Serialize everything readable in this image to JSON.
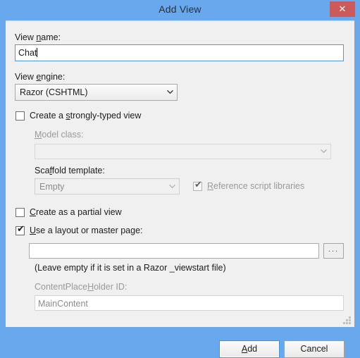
{
  "window": {
    "title": "Add View",
    "close_label": "✕",
    "titlebar_color": "#6aa8ee",
    "close_color": "#cd5a5a",
    "body_color": "#f0f0f0",
    "accent_color": "#3c99e0"
  },
  "form": {
    "view_name": {
      "label_pre": "View ",
      "label_acc": "n",
      "label_post": "ame:",
      "value": "Chat"
    },
    "view_engine": {
      "label_pre": "View ",
      "label_acc": "e",
      "label_post": "ngine:",
      "value": "Razor (CSHTML)"
    },
    "strongly_typed": {
      "label_pre": "Create a ",
      "label_acc": "s",
      "label_post": "trongly-typed view",
      "checked": false
    },
    "model_class": {
      "label_pre": "",
      "label_acc": "M",
      "label_post": "odel class:",
      "value": ""
    },
    "scaffold_template": {
      "label_pre": "Sca",
      "label_acc": "f",
      "label_post": "fold template:",
      "value": "Empty"
    },
    "reference_script_libraries": {
      "label_pre": "",
      "label_acc": "R",
      "label_post": "eference script libraries",
      "checked": true
    },
    "partial_view": {
      "label_pre": "",
      "label_acc": "C",
      "label_post": "reate as a partial view",
      "checked": false
    },
    "use_layout": {
      "label_pre": "",
      "label_acc": "U",
      "label_post": "se a layout or master page:",
      "checked": true
    },
    "layout_path": {
      "value": "",
      "browse_label": "..."
    },
    "layout_hint": "(Leave empty if it is set in a Razor _viewstart file)",
    "content_placeholder": {
      "label_pre": "ContentPlace",
      "label_acc": "H",
      "label_post": "older ID:",
      "value": "MainContent"
    }
  },
  "footer": {
    "add": {
      "pre": "",
      "acc": "A",
      "post": "dd"
    },
    "cancel": {
      "pre": "",
      "acc": "",
      "post": "Cancel"
    }
  }
}
